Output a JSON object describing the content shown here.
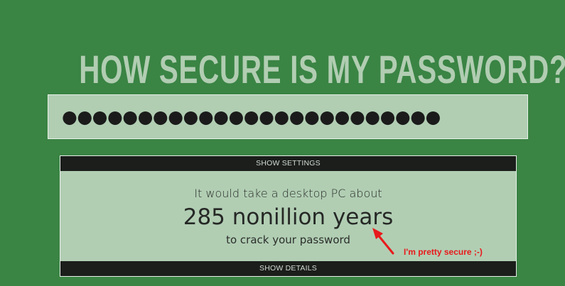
{
  "page": {
    "title": "HOW SECURE IS MY PASSWORD?"
  },
  "password_field": {
    "masked_value": "●●●●●●●●●●●●●●●●●●●●●●●●●"
  },
  "panel": {
    "show_settings_label": "SHOW SETTINGS",
    "result_prefix": "It would take a desktop PC about",
    "result_time": "285 nonillion years",
    "result_suffix": "to crack your password",
    "show_details_label": "SHOW DETAILS"
  },
  "annotation": {
    "text": "I'm pretty secure ;-)",
    "color": "#e8191b"
  },
  "colors": {
    "background": "#3a8444",
    "panel": "#b1ceb3",
    "title": "#b1cdb2",
    "bar": "#1b1e1b"
  }
}
